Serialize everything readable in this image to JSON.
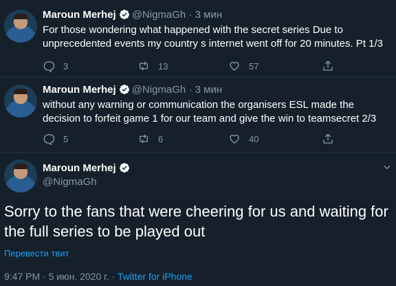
{
  "colors": {
    "background": "#15202b",
    "accent": "#1da1f2",
    "muted": "#8899a6",
    "divider": "#253341"
  },
  "thread": [
    {
      "name": "Maroun Merhej",
      "handle": "@NigmaGh",
      "separator": "·",
      "time": "3 мин",
      "text": "For those wondering what happened with the secret series Due to unprecedented events my country s internet went off for 20 minutes. Pt 1/3",
      "replies": "3",
      "retweets": "13",
      "likes": "57"
    },
    {
      "name": "Maroun Merhej",
      "handle": "@NigmaGh",
      "separator": "·",
      "time": "3 мин",
      "text": "without any warning or communication the organisers ESL made the decision to forfeit game 1 for our team and give the win to teamsecret 2/3",
      "replies": "5",
      "retweets": "6",
      "likes": "40"
    }
  ],
  "focused": {
    "name": "Maroun Merhej",
    "handle": "@NigmaGh",
    "text": "Sorry to the fans that were cheering for us and waiting for the full series to be played out",
    "translate_label": "Перевести твит",
    "time": "9:47 PM",
    "separator": "·",
    "date": "5 июн. 2020 г.",
    "source": "Twitter for iPhone"
  },
  "icons": [
    "reply-icon",
    "retweet-icon",
    "like-icon",
    "share-icon",
    "verified-badge-icon",
    "chevron-down-icon"
  ]
}
